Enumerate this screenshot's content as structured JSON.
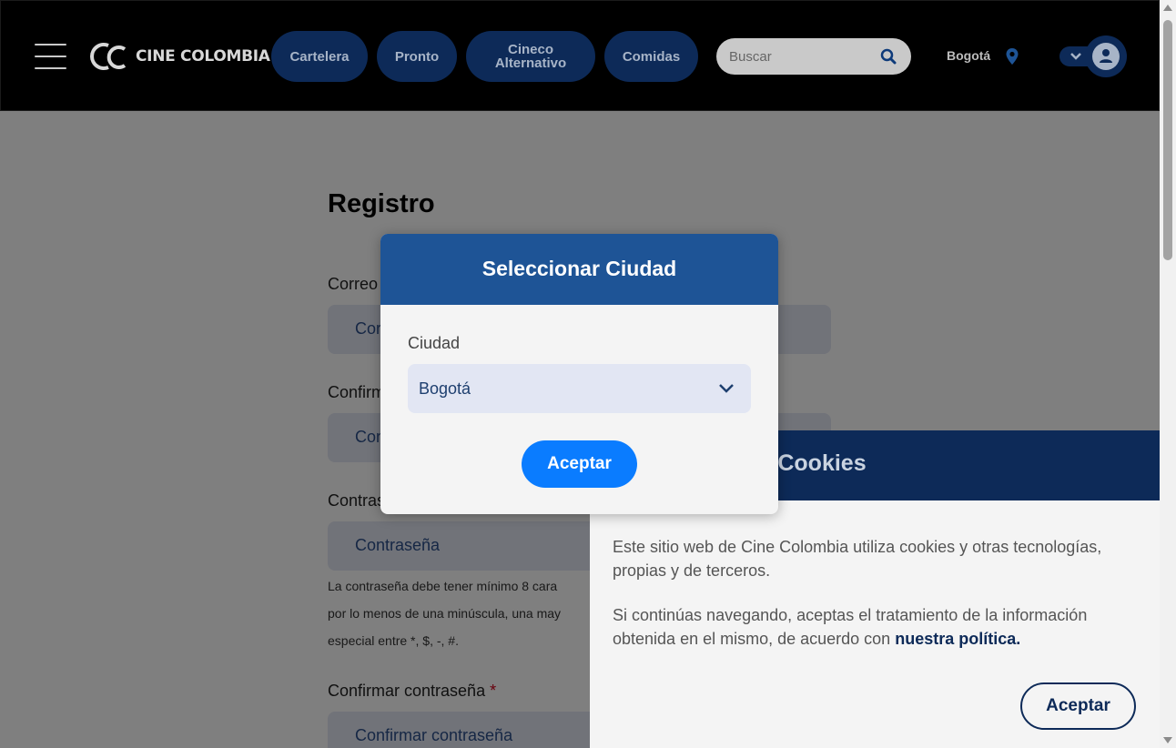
{
  "header": {
    "logo_text": "CINE COLOMBIA",
    "nav": [
      {
        "label": "Cartelera"
      },
      {
        "label": "Pronto"
      },
      {
        "label": "Cineco\nAlternativo"
      },
      {
        "label": "Comidas"
      }
    ],
    "search_placeholder": "Buscar",
    "city": "Bogotá",
    "icons": [
      "menu-icon",
      "search-icon",
      "location-pin-icon",
      "chevron-down-icon",
      "user-icon"
    ]
  },
  "form": {
    "title": "Registro",
    "fields": [
      {
        "label": "Correo",
        "placeholder": "Correo"
      },
      {
        "label": "Confirmar",
        "placeholder": "Confirmar correo"
      },
      {
        "label": "Contraseña",
        "placeholder": "Contraseña"
      },
      {
        "label": "Confirmar contraseña",
        "required": "*",
        "placeholder": "Confirmar contraseña"
      }
    ],
    "password_hint": [
      "La contraseña debe tener mínimo 8 cara",
      "por lo menos de una minúscula, una may",
      "especial entre *, $, -, #."
    ]
  },
  "cookies": {
    "title": "Cookies",
    "p1": "Este sitio web de Cine Colombia utiliza cookies y otras tecnologías, propias y de terceros.",
    "p2": "Si continúas navegando, aceptas el tratamiento de la información obtenida en el mismo, de acuerdo con",
    "link": "nuestra política.",
    "button": "Aceptar"
  },
  "modal": {
    "title": "Seleccionar Ciudad",
    "label": "Ciudad",
    "selected": "Bogotá",
    "button": "Aceptar"
  },
  "colors": {
    "header_bg": "#000000",
    "nav_btn": "#0d2a58",
    "modal_head": "#1e5496",
    "primary_button": "#0a7cff"
  }
}
